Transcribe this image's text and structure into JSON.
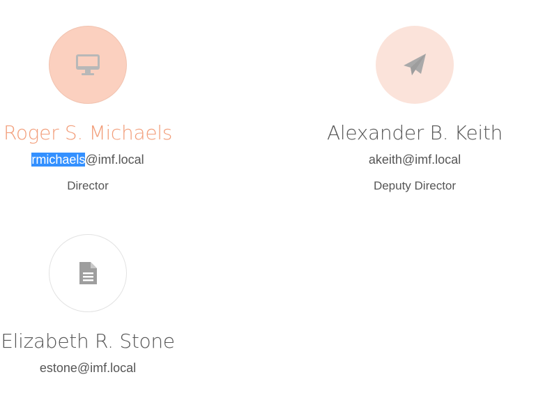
{
  "people": [
    {
      "name": "Roger S. Michaels",
      "email_user": "rmichaels",
      "email_domain": "@imf.local",
      "role": "Director",
      "icon": "monitor-icon",
      "accent": "#f29d79"
    },
    {
      "name": "Alexander B. Keith",
      "email_user": "akeith",
      "email_domain": "@imf.local",
      "role": "Deputy Director",
      "icon": "paper-plane-icon"
    },
    {
      "name": "Elizabeth R. Stone",
      "email_user": "estone",
      "email_domain": "@imf.local",
      "role": "",
      "icon": "document-icon"
    }
  ],
  "colors": {
    "accent": "#f29d79",
    "avatar_active_bg": "#fbd0bf",
    "avatar_soft_bg": "#fbe3da",
    "text": "#555555",
    "icon": "#a9a9a9",
    "selection": "#3390ff"
  }
}
